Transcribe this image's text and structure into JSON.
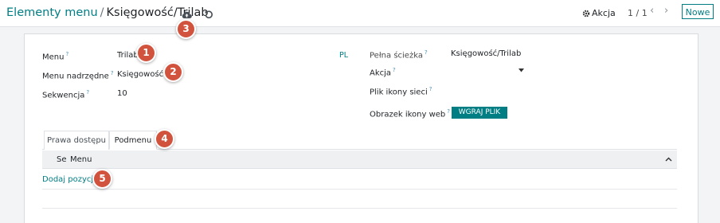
{
  "breadcrumb": {
    "parent": "Elementy menu",
    "separator": "/",
    "current": "Księgowość/Trilab"
  },
  "toolbar": {
    "save_icon": "cloud-upload-icon",
    "discard_icon": "undo-icon",
    "action_label": "Akcja",
    "pager_value": "1 / 1",
    "prev_label": "‹",
    "next_label": "›",
    "new_label": "Nowe"
  },
  "form": {
    "menu_label": "Menu",
    "menu_value": "Trilab",
    "parent_label": "Menu nadrzędne",
    "parent_value": "Księgowość",
    "sequence_label": "Sekwencja",
    "sequence_value": "10",
    "lang_badge": "PL",
    "full_path_label": "Pełna ścieżka",
    "full_path_value": "Księgowość/Trilab",
    "action_field_label": "Akcja",
    "action_field_value": "",
    "web_icon_label": "Plik ikony sieci",
    "web_icon_image_label": "Obrazek ikony web",
    "upload_label": "WGRAJ PLIK",
    "help_mark": "?"
  },
  "tabs": [
    {
      "label": "Prawa dostępu",
      "active": false
    },
    {
      "label": "Podmenu",
      "active": true
    }
  ],
  "table": {
    "columns": [
      "Se",
      "Menu"
    ],
    "add_line": "Dodaj pozycję",
    "rows": []
  },
  "callouts": [
    "1",
    "2",
    "3",
    "4",
    "5"
  ],
  "colors": {
    "accent": "#017e84",
    "callout": "#d1533d",
    "background": "#f3f4f6"
  }
}
